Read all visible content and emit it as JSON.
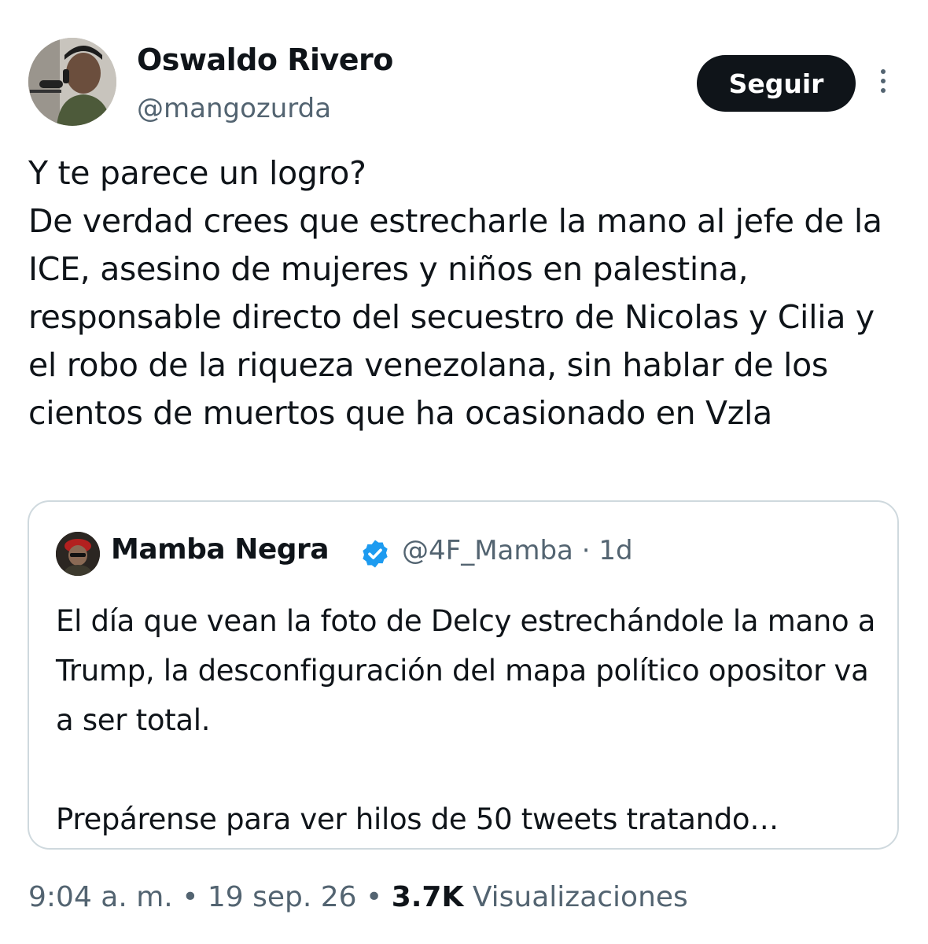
{
  "author": {
    "name": "Oswaldo Rivero",
    "handle": "@mangozurda"
  },
  "follow_button": {
    "label": "Seguir"
  },
  "more_icon": "more-vertical-icon",
  "tweet": {
    "text": "Y te parece un logro?\nDe verdad crees que estrecharle la mano al jefe de la ICE, asesino de mujeres y niños en palestina, responsable directo del secuestro de Nicolas y Cilia y el robo de la riqueza venezolana, sin hablar de los cientos de muertos que ha ocasionado en Vzla"
  },
  "quoted": {
    "name": "Mamba Negra",
    "verified_icon": "verified-badge-icon",
    "handle_time": "@4F_Mamba · 1d",
    "text": "El día que vean la foto de Delcy estrechándole la mano a Trump, la desconfiguración del mapa político opositor va a ser total.\n\nPrepárense para ver hilos de 50 tweets tratando…"
  },
  "meta": {
    "time": "9:04 a. m.",
    "separator1": " • ",
    "date": "19 sep. 26",
    "separator2": " • ",
    "views": "3.7K",
    "views_label": " Visualizaciones"
  },
  "colors": {
    "text": "#0f1419",
    "secondary": "#536471",
    "border": "#cfd9de",
    "verified": "#1d9bf0",
    "button_bg": "#0f1419"
  }
}
